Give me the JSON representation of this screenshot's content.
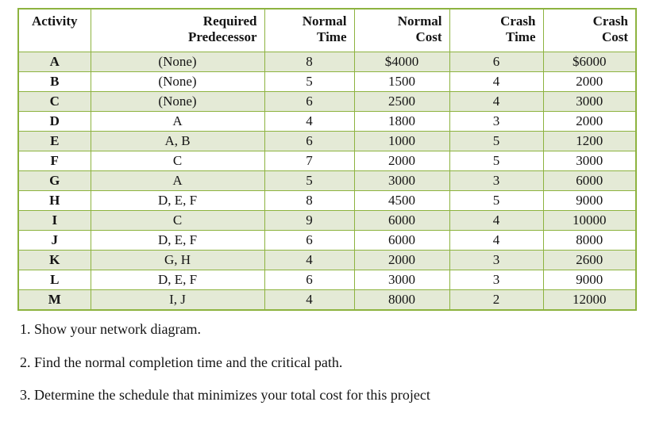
{
  "table": {
    "headers": [
      {
        "lines": [
          "Activity"
        ],
        "align": "center"
      },
      {
        "lines": [
          "Required",
          "Predecessor"
        ],
        "align": "right"
      },
      {
        "lines": [
          "Normal",
          "Time"
        ],
        "align": "right"
      },
      {
        "lines": [
          "Normal",
          "Cost"
        ],
        "align": "right"
      },
      {
        "lines": [
          "Crash",
          "Time"
        ],
        "align": "right"
      },
      {
        "lines": [
          "Crash",
          "Cost"
        ],
        "align": "right"
      }
    ],
    "rows": [
      {
        "activity": "A",
        "predecessor": "(None)",
        "normal_time": "8",
        "normal_cost": "$4000",
        "crash_time": "6",
        "crash_cost": "$6000"
      },
      {
        "activity": "B",
        "predecessor": "(None)",
        "normal_time": "5",
        "normal_cost": "1500",
        "crash_time": "4",
        "crash_cost": "2000"
      },
      {
        "activity": "C",
        "predecessor": "(None)",
        "normal_time": "6",
        "normal_cost": "2500",
        "crash_time": "4",
        "crash_cost": "3000"
      },
      {
        "activity": "D",
        "predecessor": "A",
        "normal_time": "4",
        "normal_cost": "1800",
        "crash_time": "3",
        "crash_cost": "2000"
      },
      {
        "activity": "E",
        "predecessor": "A, B",
        "normal_time": "6",
        "normal_cost": "1000",
        "crash_time": "5",
        "crash_cost": "1200"
      },
      {
        "activity": "F",
        "predecessor": "C",
        "normal_time": "7",
        "normal_cost": "2000",
        "crash_time": "5",
        "crash_cost": "3000"
      },
      {
        "activity": "G",
        "predecessor": "A",
        "normal_time": "5",
        "normal_cost": "3000",
        "crash_time": "3",
        "crash_cost": "6000"
      },
      {
        "activity": "H",
        "predecessor": "D, E, F",
        "normal_time": "8",
        "normal_cost": "4500",
        "crash_time": "5",
        "crash_cost": "9000"
      },
      {
        "activity": "I",
        "predecessor": "C",
        "normal_time": "9",
        "normal_cost": "6000",
        "crash_time": "4",
        "crash_cost": "10000"
      },
      {
        "activity": "J",
        "predecessor": "D, E, F",
        "normal_time": "6",
        "normal_cost": "6000",
        "crash_time": "4",
        "crash_cost": "8000"
      },
      {
        "activity": "K",
        "predecessor": "G, H",
        "normal_time": "4",
        "normal_cost": "2000",
        "crash_time": "3",
        "crash_cost": "2600"
      },
      {
        "activity": "L",
        "predecessor": "D, E, F",
        "normal_time": "6",
        "normal_cost": "3000",
        "crash_time": "3",
        "crash_cost": "9000"
      },
      {
        "activity": "M",
        "predecessor": "I, J",
        "normal_time": "4",
        "normal_cost": "8000",
        "crash_time": "2",
        "crash_cost": "12000"
      }
    ]
  },
  "questions": [
    "1. Show your network diagram.",
    "2. Find the normal completion time and the critical path.",
    "3. Determine the schedule that minimizes your total cost for this project"
  ],
  "colors": {
    "border_green": "#8db33f",
    "stripe_green": "#e4ead6",
    "text": "#141414",
    "page_background": "#ffffff"
  }
}
